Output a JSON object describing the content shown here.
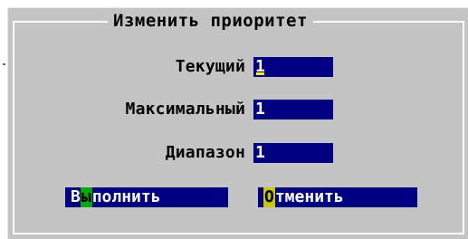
{
  "dialog": {
    "title": "Изменить приоритет"
  },
  "fields": [
    {
      "label": "Текущий",
      "value": "1"
    },
    {
      "label": "Максимальный",
      "value": "1"
    },
    {
      "label": "Диапазон",
      "value": "1"
    }
  ],
  "buttons": {
    "ok": {
      "prefix": "В",
      "hotkey": "ы",
      "rest": "полнить"
    },
    "cancel": {
      "prefix": "",
      "hotkey": "О",
      "rest": "тменить"
    }
  },
  "colors": {
    "dialog_bg": "#c4c4c4",
    "field_bg": "#000080",
    "ok_hotkey_bg": "#00a800",
    "cancel_hotkey_bg": "#c8c800",
    "cursor": "#ffff00"
  }
}
